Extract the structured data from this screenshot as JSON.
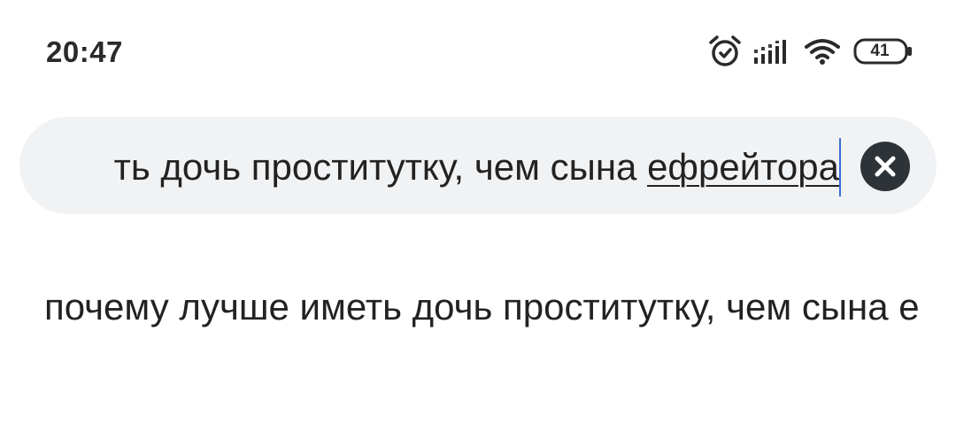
{
  "status_bar": {
    "time": "20:47",
    "battery_level": "41",
    "icons": [
      "alarm-icon",
      "signal-icon",
      "wifi-icon",
      "battery-icon"
    ]
  },
  "search": {
    "query_prefix": "ть дочь проститутку, чем сына ",
    "query_composing": "ефрейтора",
    "clear_icon": "close-icon"
  },
  "suggestions": [
    {
      "text": "почему лучше иметь дочь проститутку, чем сына е"
    }
  ],
  "colors": {
    "search_background": "#f1f2f4",
    "clear_button": "#2e3338",
    "cursor": "#3a6fd8",
    "text": "#222222"
  }
}
